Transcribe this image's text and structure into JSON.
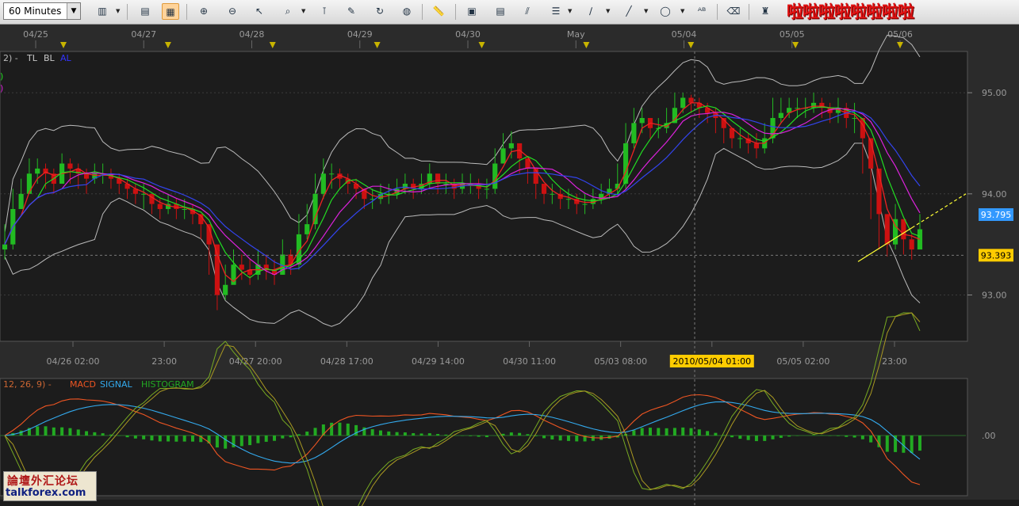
{
  "toolbar": {
    "timeframe": "60 Minutes",
    "promo_text": "啦啦啦啦啦啦啦啦",
    "icons": [
      "bar-chart-icon",
      "candlestick-icon",
      "line-chart-icon",
      "crosshair-icon",
      "zoom-in-icon",
      "zoom-out-icon",
      "cursor-icon",
      "magnifier-icon",
      "vertical-line-icon",
      "note-icon",
      "refresh-icon",
      "globe-icon",
      "ruler-icon",
      "chart-image-icon",
      "calculator-icon",
      "trendline-icon",
      "horizontal-line-icon",
      "pen-icon",
      "draw-line-icon",
      "ellipse-icon",
      "text-icon",
      "eraser-icon",
      "indicator-icon"
    ]
  },
  "chart_data": [
    {
      "type": "candlestick",
      "legend_top": "2) -",
      "legend_items": [
        {
          "name": "TL",
          "color": "#c8c8c8"
        },
        {
          "name": "BL",
          "color": "#c8c8c8"
        },
        {
          "name": "AL",
          "color": "#3333ff"
        }
      ],
      "legend_side": [
        ")",
        ")"
      ],
      "top_dates": [
        "04/25",
        "04/27",
        "04/28",
        "04/29",
        "04/30",
        "May",
        "05/04",
        "05/05",
        "05/06"
      ],
      "x_labels": [
        "04/26 02:00",
        "23:00",
        "04/27 20:00",
        "04/28 17:00",
        "04/29 14:00",
        "04/30 11:00",
        "05/03 08:00",
        "2010/05/04 01:00",
        "05/05 02:00",
        "23:00"
      ],
      "highlighted_label": "2010/05/04 01:00",
      "y_ticks": [
        93.0,
        94.0,
        95.0
      ],
      "y_tick_labels": [
        "93.00",
        "94.00",
        "95.00"
      ],
      "ylim": [
        92.55,
        95.4
      ],
      "current_price": "93.795",
      "crosshair_price": "93.393",
      "crosshair_price_value": 93.393,
      "colors": {
        "up": "#22bb22",
        "down": "#cc1111",
        "ma_fast": "#ee2222",
        "ma_mid": "#22dd22",
        "ma_slow": "#dd22dd",
        "ma_long": "#3344ee",
        "bands": "#bbbbbb",
        "trendline": "#ffff33",
        "price_tag": "#3399ff",
        "cross_tag": "#ffcc00"
      },
      "closes": [
        93.5,
        93.85,
        94.0,
        94.2,
        94.25,
        94.2,
        94.1,
        94.3,
        94.25,
        94.2,
        94.15,
        94.2,
        94.2,
        94.15,
        94.1,
        94.05,
        94.0,
        94.0,
        93.9,
        93.85,
        93.9,
        93.85,
        93.85,
        93.8,
        93.7,
        93.5,
        93.0,
        93.1,
        93.3,
        93.25,
        93.2,
        93.3,
        93.25,
        93.2,
        93.4,
        93.3,
        93.6,
        93.7,
        94.0,
        94.2,
        94.2,
        94.15,
        94.1,
        94.05,
        93.95,
        93.95,
        94.0,
        94.0,
        94.05,
        94.1,
        94.05,
        94.1,
        94.2,
        94.1,
        94.1,
        94.05,
        94.1,
        94.1,
        94.05,
        94.05,
        94.3,
        94.45,
        94.5,
        94.35,
        94.25,
        94.1,
        94.0,
        94.0,
        93.95,
        93.95,
        93.9,
        93.9,
        93.95,
        94.0,
        94.05,
        94.1,
        94.5,
        94.7,
        94.75,
        94.65,
        94.65,
        94.7,
        94.85,
        94.95,
        94.9,
        94.85,
        94.8,
        94.75,
        94.65,
        94.55,
        94.55,
        94.5,
        94.45,
        94.55,
        94.75,
        94.8,
        94.85,
        94.85,
        94.85,
        94.9,
        94.85,
        94.8,
        94.85,
        94.75,
        94.75,
        94.55,
        94.25,
        93.8,
        93.5,
        93.75,
        93.55,
        93.45,
        93.65
      ],
      "highs": [
        93.7,
        94.05,
        94.15,
        94.35,
        94.35,
        94.3,
        94.25,
        94.4,
        94.35,
        94.3,
        94.25,
        94.3,
        94.3,
        94.25,
        94.2,
        94.15,
        94.1,
        94.1,
        94.0,
        93.95,
        94.0,
        93.95,
        93.95,
        93.9,
        93.8,
        93.6,
        93.3,
        93.3,
        93.45,
        93.4,
        93.35,
        93.45,
        93.4,
        93.35,
        93.55,
        93.45,
        93.8,
        93.9,
        94.2,
        94.35,
        94.3,
        94.25,
        94.2,
        94.15,
        94.05,
        94.05,
        94.1,
        94.1,
        94.15,
        94.2,
        94.15,
        94.2,
        94.3,
        94.2,
        94.2,
        94.15,
        94.2,
        94.2,
        94.15,
        94.15,
        94.45,
        94.6,
        94.62,
        94.45,
        94.35,
        94.2,
        94.1,
        94.1,
        94.05,
        94.05,
        94.0,
        94.0,
        94.05,
        94.1,
        94.15,
        94.3,
        94.7,
        94.85,
        94.85,
        94.75,
        94.75,
        94.85,
        95.0,
        95.0,
        94.98,
        94.95,
        94.9,
        94.85,
        94.75,
        94.65,
        94.65,
        94.6,
        94.6,
        94.7,
        94.95,
        94.95,
        94.95,
        94.95,
        94.95,
        95.0,
        94.95,
        94.9,
        94.95,
        94.9,
        94.9,
        94.75,
        94.5,
        94.1,
        93.75,
        93.9,
        93.75,
        93.6,
        93.8
      ],
      "lows": [
        93.35,
        93.45,
        93.85,
        94.0,
        94.1,
        94.05,
        94.0,
        94.15,
        94.1,
        94.05,
        94.0,
        94.1,
        94.1,
        94.05,
        94.0,
        93.95,
        93.9,
        93.85,
        93.8,
        93.75,
        93.8,
        93.75,
        93.75,
        93.7,
        93.55,
        93.2,
        92.85,
        92.95,
        93.15,
        93.15,
        93.1,
        93.15,
        93.15,
        93.1,
        93.2,
        93.2,
        93.25,
        93.55,
        93.65,
        93.95,
        94.05,
        94.05,
        94.0,
        93.95,
        93.85,
        93.85,
        93.9,
        93.9,
        93.95,
        94.0,
        93.95,
        94.0,
        94.05,
        94.0,
        94.0,
        93.95,
        94.0,
        94.0,
        93.95,
        93.95,
        94.0,
        94.3,
        94.35,
        94.2,
        94.1,
        93.95,
        93.9,
        93.9,
        93.85,
        93.85,
        93.8,
        93.8,
        93.85,
        93.9,
        93.95,
        94.0,
        94.05,
        94.45,
        94.6,
        94.55,
        94.55,
        94.6,
        94.7,
        94.8,
        94.8,
        94.75,
        94.7,
        94.6,
        94.5,
        94.45,
        94.45,
        94.4,
        94.35,
        94.4,
        94.5,
        94.7,
        94.75,
        94.75,
        94.75,
        94.8,
        94.75,
        94.7,
        94.7,
        94.65,
        94.6,
        94.2,
        93.75,
        93.45,
        93.38,
        93.45,
        93.4,
        93.35,
        93.45
      ],
      "trendline_prices": [
        93.33,
        94.0
      ]
    },
    {
      "type": "line",
      "legend_params": "12, 26, 9) -",
      "series": [
        {
          "name": "MACD",
          "color": "#ee5522"
        },
        {
          "name": "SIGNAL",
          "color": "#33aaee"
        },
        {
          "name": "HISTOGRAM",
          "color": "#22aa22"
        }
      ],
      "extra_lines": [
        {
          "color": "#77aa22"
        },
        {
          "color": "#aa9922"
        }
      ],
      "y_tick_labels": [
        ".00"
      ],
      "zero_value": 0
    }
  ]
}
